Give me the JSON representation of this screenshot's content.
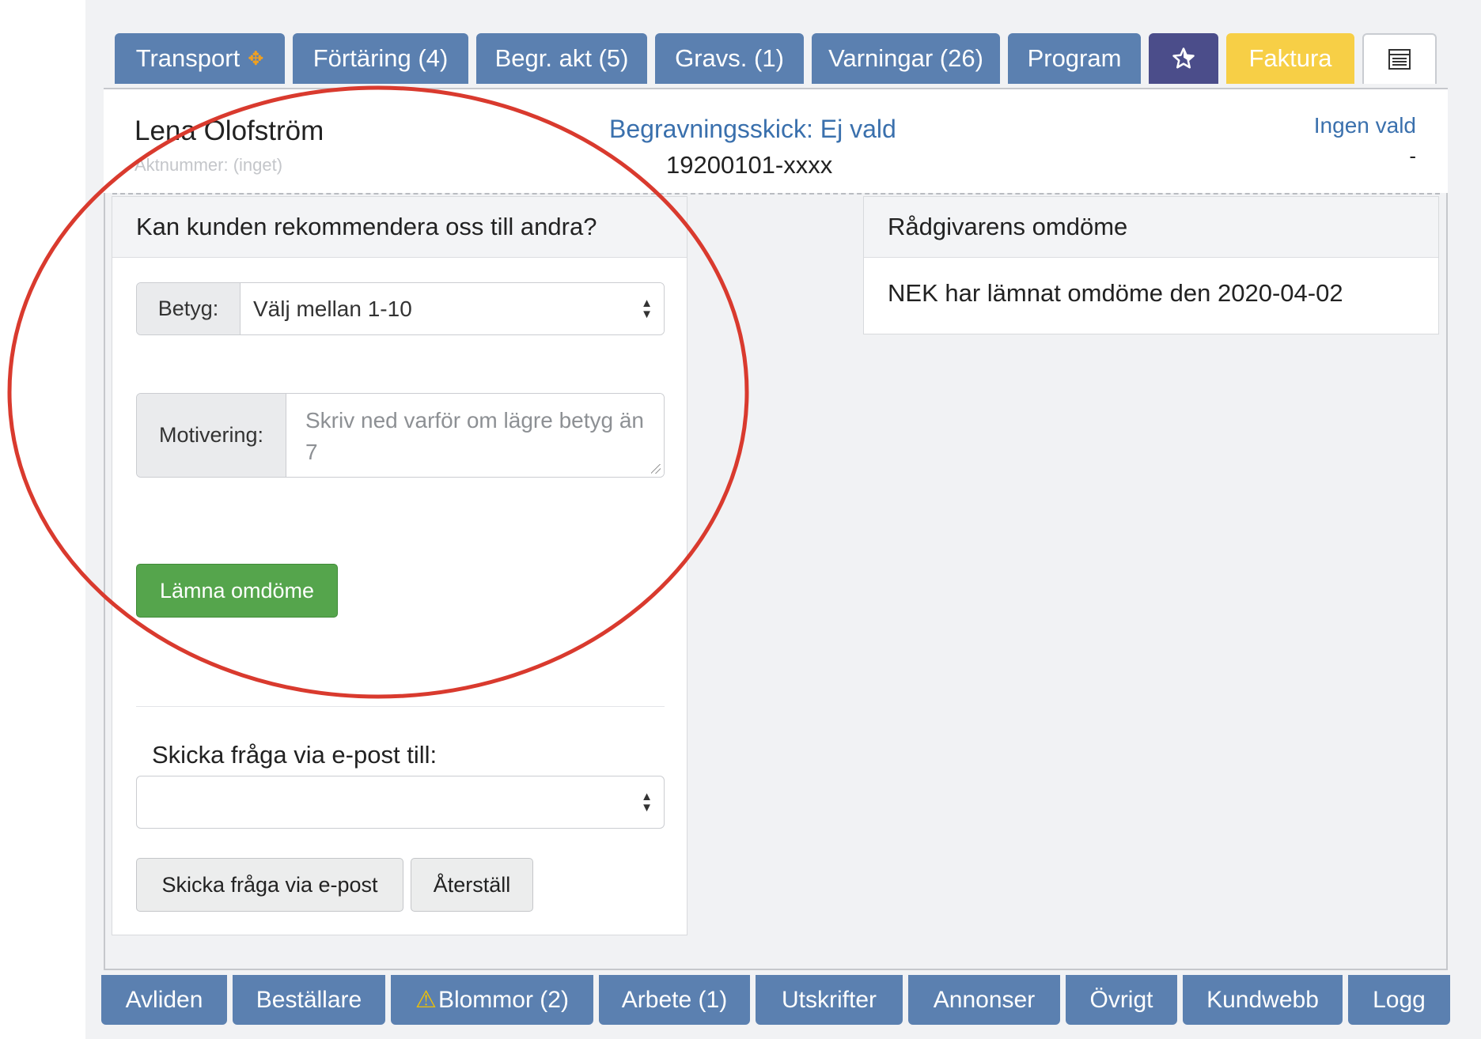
{
  "top_tabs": [
    {
      "label": "Transport",
      "icon": "move-icon"
    },
    {
      "label": "Förtäring (4)"
    },
    {
      "label": "Begr. akt (5)"
    },
    {
      "label": "Gravs. (1)"
    },
    {
      "label": "Varningar (26)"
    },
    {
      "label": "Program"
    },
    {
      "icon": "star-icon"
    },
    {
      "label": "Faktura"
    },
    {
      "icon": "list-icon"
    }
  ],
  "header": {
    "name": "Lena Olofström",
    "akt_number": "Aktnummer: (inget)",
    "begravningsskick": "Begravningsskick: Ej vald",
    "personnummer": "19200101-xxxx",
    "ingen_vald": "Ingen vald",
    "dash": "-"
  },
  "recommend_card": {
    "title": "Kan kunden rekommendera oss till andra?",
    "betyg_label": "Betyg:",
    "betyg_select_value": "Välj mellan 1-10",
    "motivering_label": "Motivering:",
    "motivering_placeholder": "Skriv ned varför om lägre betyg än 7",
    "submit_label": "Lämna omdöme",
    "email_label": "Skicka fråga via e-post till:",
    "email_select_value": "",
    "send_label": "Skicka fråga via e-post",
    "reset_label": "Återställ"
  },
  "advisor_card": {
    "title": "Rådgivarens omdöme",
    "text": "NEK har lämnat omdöme den 2020-04-02"
  },
  "bottom_tabs": [
    {
      "label": "Avliden"
    },
    {
      "label": "Beställare"
    },
    {
      "label": "Blommor (2)",
      "icon": "warning-icon"
    },
    {
      "label": "Arbete (1)"
    },
    {
      "label": "Utskrifter"
    },
    {
      "label": "Annonser"
    },
    {
      "label": "Övrigt"
    },
    {
      "label": "Kundwebb"
    },
    {
      "label": "Logg"
    }
  ],
  "colors": {
    "tab_blue": "#5b80b0",
    "star_tab": "#4b4d8a",
    "faktura_tab": "#f7cf46",
    "link_blue": "#3a70ad",
    "submit_green": "#55a54c",
    "annotation_red": "#d93a2e"
  }
}
